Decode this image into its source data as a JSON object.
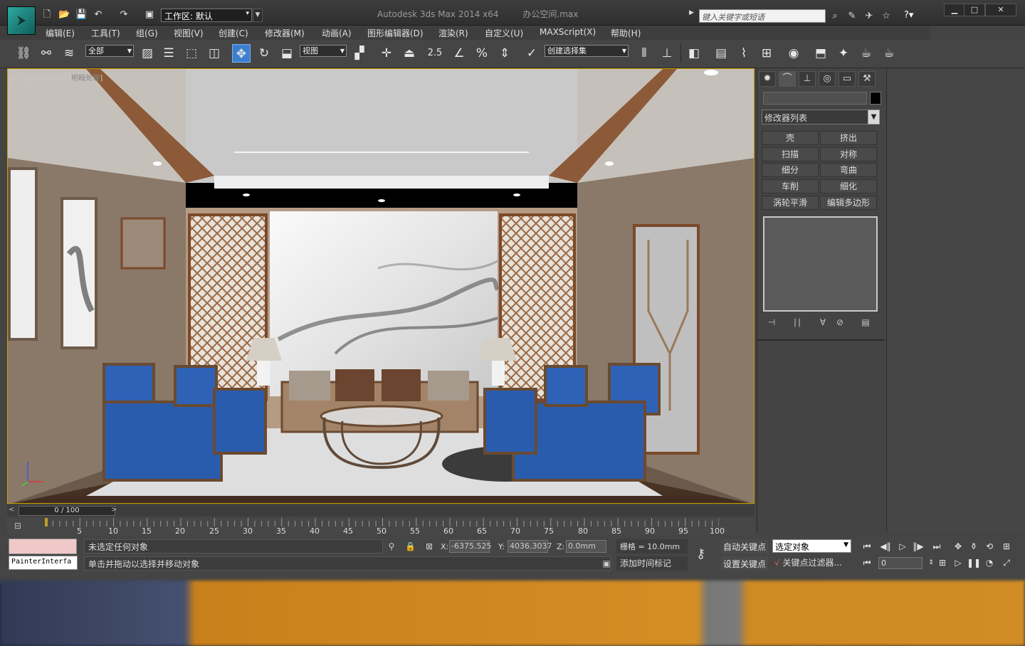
{
  "title": {
    "workspace": "工作区: 默认",
    "app": "Autodesk 3ds Max  2014 x64",
    "file": "办公空间.max",
    "search_placeholder": "键入关键字或短语"
  },
  "menu": [
    "编辑(E)",
    "工具(T)",
    "组(G)",
    "视图(V)",
    "创建(C)",
    "修改器(M)",
    "动画(A)",
    "图形编辑器(D)",
    "渲染(R)",
    "自定义(U)",
    "MAXScript(X)",
    "帮助(H)"
  ],
  "toolbar": {
    "filter": "全部",
    "ref_coord": "视图",
    "selection_set": "创建选择集"
  },
  "viewport": {
    "label_main": "[+] [Camera01] [",
    "label_shading": "明暗处理",
    "label_end": "]"
  },
  "command_panel": {
    "modifier_list": "修改器列表",
    "modifier_buttons": [
      "壳",
      "挤出",
      "扫描",
      "对称",
      "细分",
      "弯曲",
      "车削",
      "细化",
      "涡轮平滑",
      "编辑多边形"
    ]
  },
  "timeline": {
    "position": "0 / 100",
    "ticks": [
      "5",
      "10",
      "15",
      "20",
      "25",
      "30",
      "35",
      "40",
      "45",
      "50",
      "55",
      "60",
      "65",
      "70",
      "75",
      "80",
      "85",
      "90",
      "95",
      "100"
    ]
  },
  "status": {
    "listener": "PainterInterfa",
    "selection": "未选定任何对象",
    "prompt": "单击并拖动以选择并移动对象",
    "x_label": "X:",
    "x": "-6375.525",
    "y_label": "Y:",
    "y": "4036.3037",
    "z_label": "Z:",
    "z": "0.0mm",
    "grid": "栅格 = 10.0mm",
    "add_time_tag": "添加时间标记",
    "auto_key": "自动关键点",
    "set_key": "设置关键点",
    "key_mode": "选定对象",
    "key_filters": "关键点过滤器...",
    "frame": "0"
  }
}
